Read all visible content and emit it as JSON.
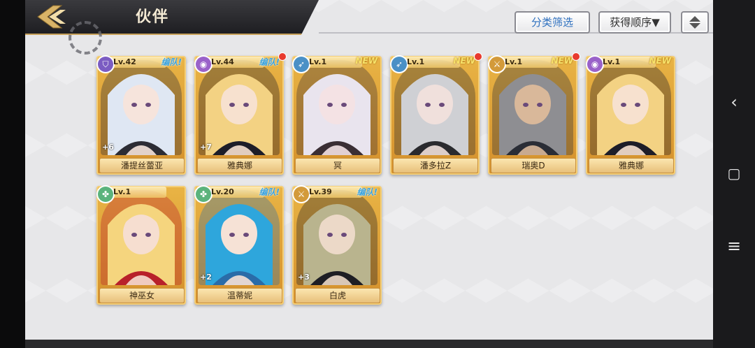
{
  "header": {
    "title": "伙伴",
    "filter_label": "分类筛选",
    "sort_label": "获得顺序▼"
  },
  "colors": {
    "accent_gold": "#e9b445",
    "filter_text": "#2d6fbe",
    "team_tag": "#3aa3e0",
    "new_tag": "#f7e26a",
    "notify_dot": "#e83a2e"
  },
  "cards": [
    {
      "name": "潘提丝蕾亚",
      "level": "Lv.42",
      "tag": "编队!",
      "plus": "+6",
      "badge_icon": "shield-icon",
      "badge_color": "#7b5cc2",
      "hair": "#dfe7f3",
      "skin": "#f6e4dc",
      "cloth": "#2c2c34",
      "red_dot": false
    },
    {
      "name": "雅典娜",
      "level": "Lv.44",
      "tag": "编队!",
      "plus": "+7",
      "badge_icon": "orb-icon",
      "badge_color": "#9a62c9",
      "hair": "#f3d283",
      "skin": "#f7e1cf",
      "cloth": "#1d1d28",
      "red_dot": true
    },
    {
      "name": "冥",
      "level": "Lv.1",
      "tag": "NEW",
      "plus": "",
      "badge_icon": "bow-icon",
      "badge_color": "#4a90c6",
      "hair": "#e9e4ee",
      "skin": "#f4e2e4",
      "cloth": "#3a2e34",
      "red_dot": false
    },
    {
      "name": "潘多拉Z",
      "level": "Lv.1",
      "tag": "NEW",
      "plus": "",
      "badge_icon": "bow-icon",
      "badge_color": "#4a90c6",
      "hair": "#cfd0d4",
      "skin": "#f0e0dc",
      "cloth": "#2a2a2e",
      "red_dot": true
    },
    {
      "name": "瑞奥D",
      "level": "Lv.1",
      "tag": "NEW",
      "plus": "",
      "badge_icon": "sword-icon",
      "badge_color": "#d39a3a",
      "hair": "#8e8e92",
      "skin": "#d9b89a",
      "cloth": "#2a2d36",
      "red_dot": true
    },
    {
      "name": "雅典娜",
      "level": "Lv.1",
      "tag": "NEW",
      "plus": "",
      "badge_icon": "orb-icon",
      "badge_color": "#9a62c9",
      "hair": "#f3d283",
      "skin": "#f7e1cf",
      "cloth": "#1d1d28",
      "red_dot": false
    },
    {
      "name": "神巫女",
      "level": "Lv.1",
      "tag": "",
      "plus": "",
      "badge_icon": "clover-icon",
      "badge_color": "#5bb37c",
      "hair": "#f5d57e",
      "skin": "#f6ded0",
      "cloth": "#b8202a",
      "red_dot": false
    },
    {
      "name": "温蒂妮",
      "level": "Lv.20",
      "tag": "编队!",
      "plus": "+2",
      "badge_icon": "clover-icon",
      "badge_color": "#5bb37c",
      "hair": "#2ea6dc",
      "skin": "#f6e2d6",
      "cloth": "#2a6ca8",
      "red_dot": false
    },
    {
      "name": "白虎",
      "level": "Lv.39",
      "tag": "编队!",
      "plus": "+3",
      "badge_icon": "sword-icon",
      "badge_color": "#d39a3a",
      "hair": "#b9b48e",
      "skin": "#ecd9c8",
      "cloth": "#1e1e24",
      "red_dot": false
    }
  ],
  "system_nav": {
    "back": "‹",
    "home": "▢",
    "menu": "≡"
  }
}
